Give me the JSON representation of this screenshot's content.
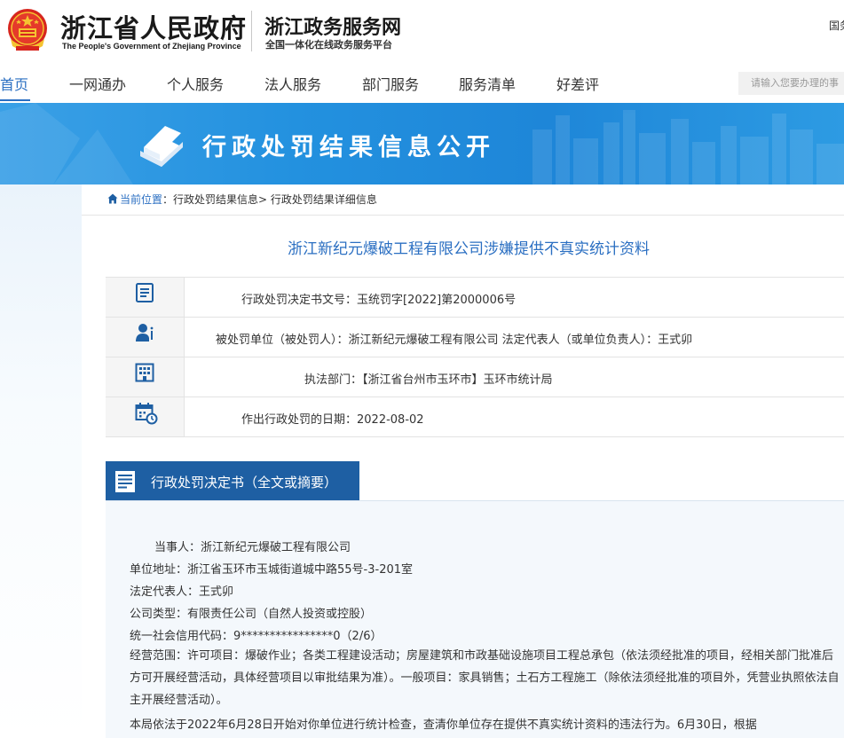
{
  "header": {
    "gov_title": "浙江省人民政府",
    "gov_subtitle": "The People's Government of Zhejiang Province",
    "site_title": "浙江政务服务网",
    "site_subtitle": "全国一体化在线政务服务平台",
    "top_right_text": "国务"
  },
  "nav": {
    "items": [
      {
        "label": "首页"
      },
      {
        "label": "一网通办"
      },
      {
        "label": "个人服务"
      },
      {
        "label": "法人服务"
      },
      {
        "label": "部门服务"
      },
      {
        "label": "服务清单"
      },
      {
        "label": "好差评"
      }
    ],
    "search_placeholder": "请输入您要办理的事"
  },
  "banner": {
    "title": "行政处罚结果信息公开"
  },
  "breadcrumb": {
    "current_label": "当前位置",
    "sep": "：",
    "level1": "行政处罚结果信息",
    "level2": "> 行政处罚结果详细信息"
  },
  "case": {
    "title": "浙江新纪元爆破工程有限公司涉嫌提供不真实统计资料",
    "rows": [
      {
        "icon": "document-icon",
        "text": "行政处罚决定书文号：玉统罚字[2022]第2000006号"
      },
      {
        "icon": "person-icon",
        "text": "被处罚单位（被处罚人）：浙江新纪元爆破工程有限公司     法定代表人（或单位负责人）：王式卯"
      },
      {
        "icon": "building-icon",
        "text": "执法部门：【浙江省台州市玉环市】玉环市统计局"
      },
      {
        "icon": "calendar-icon",
        "text": "作出行政处罚的日期：2022-08-02"
      }
    ]
  },
  "decision": {
    "tab_label": "行政处罚决定书（全文或摘要）",
    "lines": [
      "当事人：浙江新纪元爆破工程有限公司",
      "单位地址：浙江省玉环市玉城街道城中路55号-3-201室",
      "法定代表人：王式卯",
      "公司类型：有限责任公司（自然人投资或控股）",
      "统一社会信用代码：9****************0（2/6）"
    ],
    "scope_paragraph": "经营范围：许可项目：爆破作业；各类工程建设活动；房屋建筑和市政基础设施项目工程总承包（依法须经批准的项目，经相关部门批准后方可开展经营活动，具体经营项目以审批结果为准）。一般项目：家具销售；土石方工程施工（除依法须经批准的项目外，凭营业执照依法自主开展经营活动）。",
    "last_paragraph": "本局依法于2022年6月28日开始对你单位进行统计检查，查清你单位存在提供不真实统计资料的违法行为。6月30日，根据"
  },
  "colors": {
    "accent": "#2b6fc2",
    "section_tab": "#1e5fa3",
    "banner": "#2391df"
  }
}
